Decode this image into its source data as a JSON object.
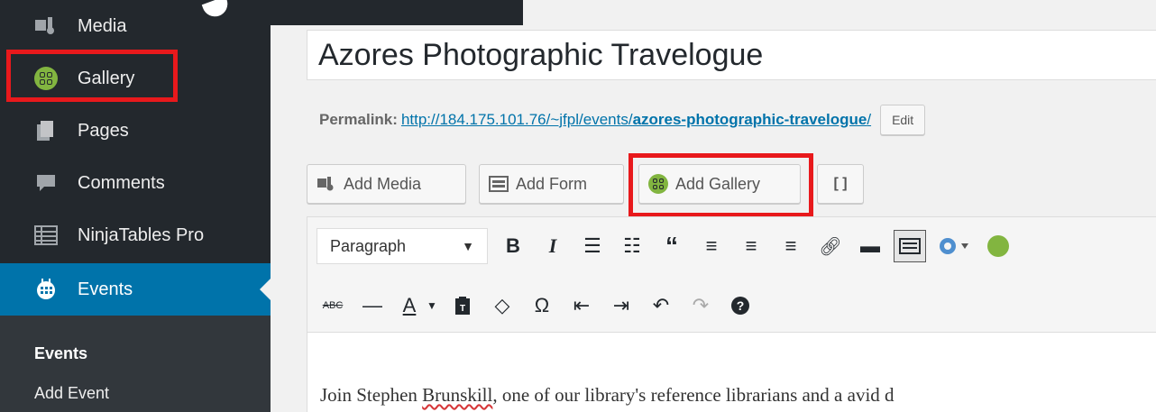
{
  "sidebar": {
    "items": [
      {
        "label": "Media",
        "icon": "media-icon"
      },
      {
        "label": "Gallery",
        "icon": "gallery-icon"
      },
      {
        "label": "Pages",
        "icon": "pages-icon"
      },
      {
        "label": "Comments",
        "icon": "comments-icon"
      },
      {
        "label": "NinjaTables Pro",
        "icon": "table-icon"
      },
      {
        "label": "Events",
        "icon": "calendar-icon"
      }
    ],
    "submenu": [
      {
        "label": "Events"
      },
      {
        "label": "Add Event"
      }
    ]
  },
  "editor": {
    "title": "Azores Photographic Travelogue",
    "permalink_label": "Permalink:",
    "permalink_base": "http://184.175.101.76/~jfpl/events/",
    "permalink_slug": "azores-photographic-travelogue",
    "permalink_trailing": "/",
    "edit_label": "Edit",
    "media_buttons": {
      "add_media": "Add Media",
      "add_form": "Add Form",
      "add_gallery": "Add Gallery",
      "shortcode": "[ ]"
    },
    "format_select": "Paragraph",
    "body_prefix": "Join Stephen ",
    "body_misspelled": "Brunskill",
    "body_suffix": ", one of our library's reference librarians and a avid d"
  },
  "colors": {
    "sidebar_bg": "#23282d",
    "active_bg": "#0073aa",
    "highlight": "#e8191c",
    "gallery_green": "#82b540"
  }
}
